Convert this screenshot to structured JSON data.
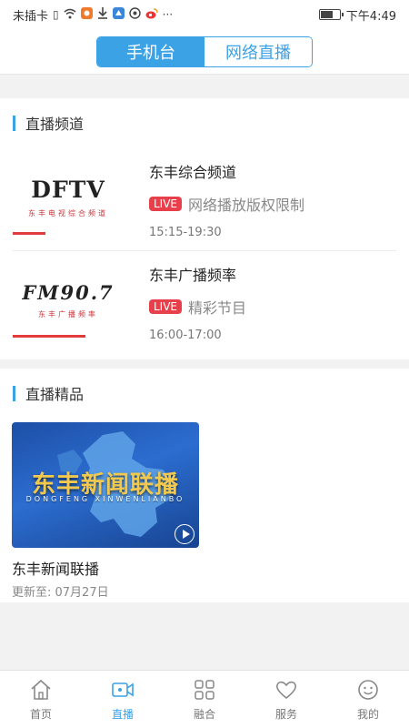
{
  "status_bar": {
    "carrier": "未插卡",
    "time": "下午4:49",
    "battery_level": 0.6,
    "icons": [
      "sim-icon",
      "wifi-icon",
      "app-orange-icon",
      "download-icon",
      "app-blue-icon",
      "location-icon",
      "weibo-icon",
      "more-icon"
    ],
    "more": "···"
  },
  "top_tabs": [
    {
      "label": "手机台",
      "active": true
    },
    {
      "label": "网络直播",
      "active": false
    }
  ],
  "live_channels": {
    "section_title": "直播频道",
    "items": [
      {
        "logo_text": "DFTV",
        "logo_subtext": "东丰电视综合频道",
        "name": "东丰综合频道",
        "badge": "LIVE",
        "desc": "网络播放版权限制",
        "time": "15:15-19:30"
      },
      {
        "logo_text": "FM90.7",
        "logo_subtext": "东丰广播频率",
        "name": "东丰广播频率",
        "badge": "LIVE",
        "desc": "精彩节目",
        "time": "16:00-17:00"
      }
    ]
  },
  "featured": {
    "section_title": "直播精品",
    "items": [
      {
        "thumb_title": "东丰新闻联播",
        "thumb_pinyin": "DONGFENG XINWENLIANBO",
        "name": "东丰新闻联播",
        "updated": "更新至: 07月27日"
      }
    ]
  },
  "tab_bar": [
    {
      "label": "首页",
      "icon": "home-icon",
      "active": false
    },
    {
      "label": "直播",
      "icon": "camera-icon",
      "active": true
    },
    {
      "label": "融合",
      "icon": "grid-icon",
      "active": false
    },
    {
      "label": "服务",
      "icon": "heart-icon",
      "active": false
    },
    {
      "label": "我的",
      "icon": "smiley-icon",
      "active": false
    }
  ],
  "colors": {
    "accent": "#3ba2e6",
    "live_badge": "#e8404a",
    "underline": "#e33b3b",
    "background": "#f2f2f2"
  }
}
